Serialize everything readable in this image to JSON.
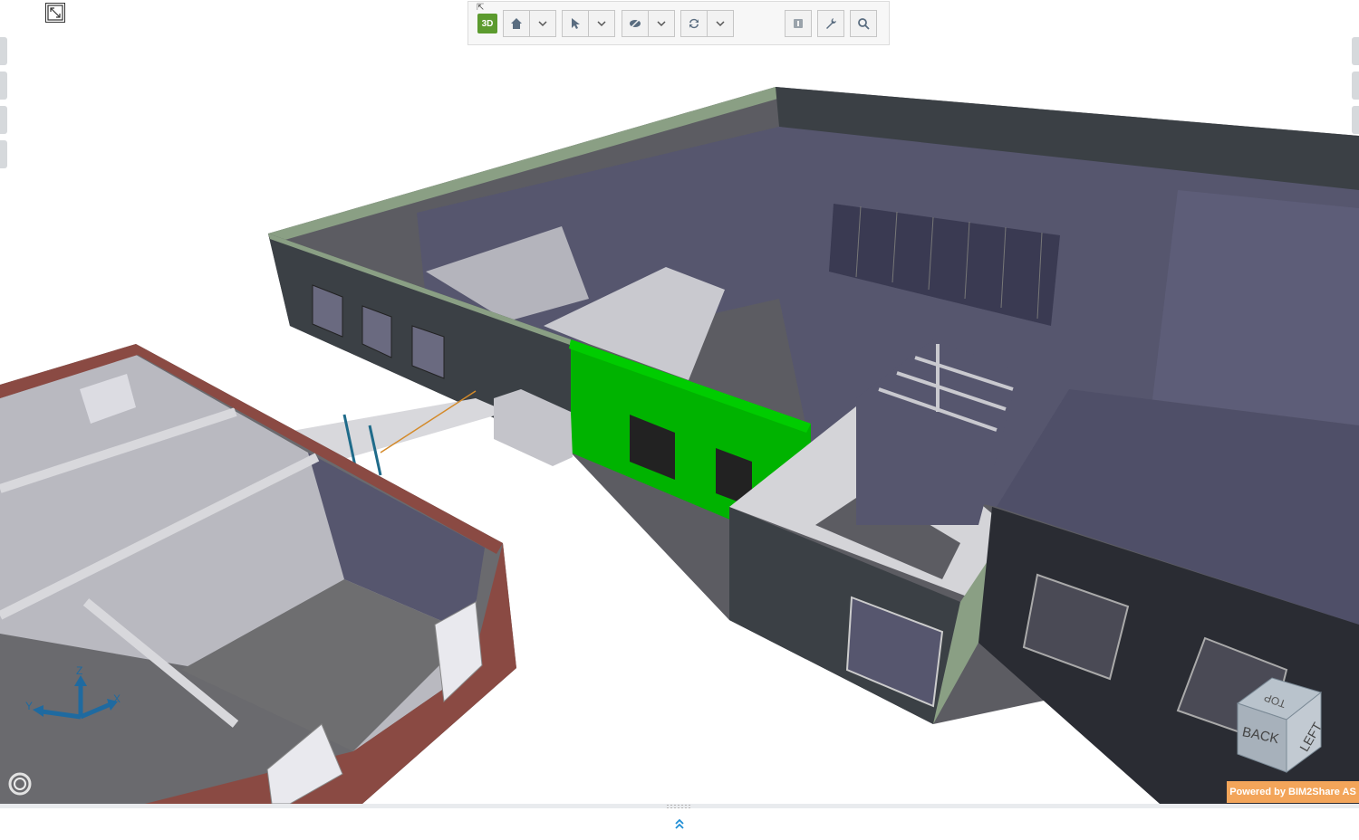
{
  "toolbar": {
    "view_mode": "3D",
    "buttons": [
      {
        "name": "home",
        "icon": "home-icon"
      },
      {
        "name": "home-options",
        "icon": "chevron-down-icon"
      },
      {
        "name": "select",
        "icon": "cursor-icon"
      },
      {
        "name": "select-options",
        "icon": "chevron-down-icon"
      },
      {
        "name": "visibility",
        "icon": "eye-off-icon"
      },
      {
        "name": "visibility-options",
        "icon": "chevron-down-icon"
      },
      {
        "name": "refresh",
        "icon": "refresh-icon"
      },
      {
        "name": "refresh-options",
        "icon": "chevron-down-icon"
      },
      {
        "name": "info",
        "icon": "info-icon"
      },
      {
        "name": "settings",
        "icon": "wrench-icon"
      },
      {
        "name": "search",
        "icon": "search-icon"
      }
    ]
  },
  "axes": {
    "x": "X",
    "y": "Y",
    "z": "Z"
  },
  "navcube": {
    "top": "TOP",
    "back": "BACK",
    "left": "LEFT"
  },
  "footer": {
    "powered_by": "Powered by BIM2Share AS"
  },
  "colors": {
    "highlight": "#00b300",
    "wall_purple": "#56566e",
    "wall_dark": "#3b4045",
    "roof_green": "#8a9f84",
    "brick": "#8a4a43",
    "accent_orange": "#f3a55a",
    "accent_green": "#5c9b2f"
  }
}
